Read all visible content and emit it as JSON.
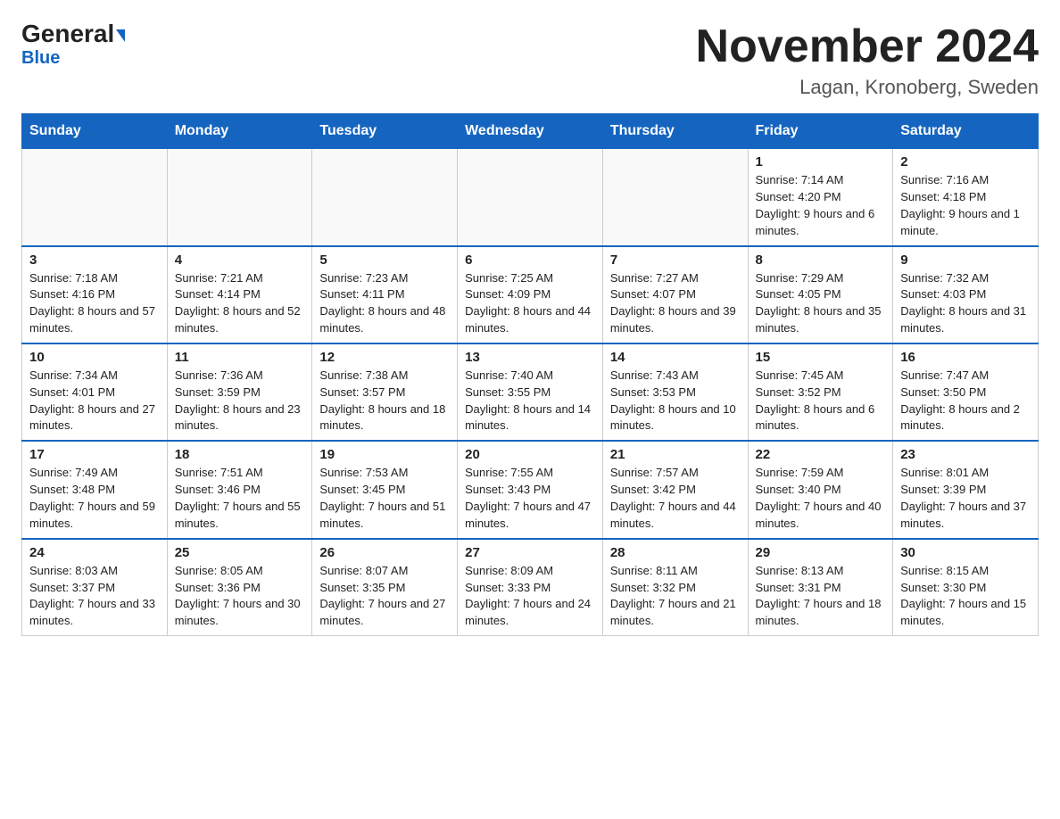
{
  "header": {
    "logo_general": "General",
    "logo_blue": "Blue",
    "month_title": "November 2024",
    "location": "Lagan, Kronoberg, Sweden"
  },
  "weekdays": [
    "Sunday",
    "Monday",
    "Tuesday",
    "Wednesday",
    "Thursday",
    "Friday",
    "Saturday"
  ],
  "weeks": [
    [
      {
        "day": "",
        "info": ""
      },
      {
        "day": "",
        "info": ""
      },
      {
        "day": "",
        "info": ""
      },
      {
        "day": "",
        "info": ""
      },
      {
        "day": "",
        "info": ""
      },
      {
        "day": "1",
        "info": "Sunrise: 7:14 AM\nSunset: 4:20 PM\nDaylight: 9 hours and 6 minutes."
      },
      {
        "day": "2",
        "info": "Sunrise: 7:16 AM\nSunset: 4:18 PM\nDaylight: 9 hours and 1 minute."
      }
    ],
    [
      {
        "day": "3",
        "info": "Sunrise: 7:18 AM\nSunset: 4:16 PM\nDaylight: 8 hours and 57 minutes."
      },
      {
        "day": "4",
        "info": "Sunrise: 7:21 AM\nSunset: 4:14 PM\nDaylight: 8 hours and 52 minutes."
      },
      {
        "day": "5",
        "info": "Sunrise: 7:23 AM\nSunset: 4:11 PM\nDaylight: 8 hours and 48 minutes."
      },
      {
        "day": "6",
        "info": "Sunrise: 7:25 AM\nSunset: 4:09 PM\nDaylight: 8 hours and 44 minutes."
      },
      {
        "day": "7",
        "info": "Sunrise: 7:27 AM\nSunset: 4:07 PM\nDaylight: 8 hours and 39 minutes."
      },
      {
        "day": "8",
        "info": "Sunrise: 7:29 AM\nSunset: 4:05 PM\nDaylight: 8 hours and 35 minutes."
      },
      {
        "day": "9",
        "info": "Sunrise: 7:32 AM\nSunset: 4:03 PM\nDaylight: 8 hours and 31 minutes."
      }
    ],
    [
      {
        "day": "10",
        "info": "Sunrise: 7:34 AM\nSunset: 4:01 PM\nDaylight: 8 hours and 27 minutes."
      },
      {
        "day": "11",
        "info": "Sunrise: 7:36 AM\nSunset: 3:59 PM\nDaylight: 8 hours and 23 minutes."
      },
      {
        "day": "12",
        "info": "Sunrise: 7:38 AM\nSunset: 3:57 PM\nDaylight: 8 hours and 18 minutes."
      },
      {
        "day": "13",
        "info": "Sunrise: 7:40 AM\nSunset: 3:55 PM\nDaylight: 8 hours and 14 minutes."
      },
      {
        "day": "14",
        "info": "Sunrise: 7:43 AM\nSunset: 3:53 PM\nDaylight: 8 hours and 10 minutes."
      },
      {
        "day": "15",
        "info": "Sunrise: 7:45 AM\nSunset: 3:52 PM\nDaylight: 8 hours and 6 minutes."
      },
      {
        "day": "16",
        "info": "Sunrise: 7:47 AM\nSunset: 3:50 PM\nDaylight: 8 hours and 2 minutes."
      }
    ],
    [
      {
        "day": "17",
        "info": "Sunrise: 7:49 AM\nSunset: 3:48 PM\nDaylight: 7 hours and 59 minutes."
      },
      {
        "day": "18",
        "info": "Sunrise: 7:51 AM\nSunset: 3:46 PM\nDaylight: 7 hours and 55 minutes."
      },
      {
        "day": "19",
        "info": "Sunrise: 7:53 AM\nSunset: 3:45 PM\nDaylight: 7 hours and 51 minutes."
      },
      {
        "day": "20",
        "info": "Sunrise: 7:55 AM\nSunset: 3:43 PM\nDaylight: 7 hours and 47 minutes."
      },
      {
        "day": "21",
        "info": "Sunrise: 7:57 AM\nSunset: 3:42 PM\nDaylight: 7 hours and 44 minutes."
      },
      {
        "day": "22",
        "info": "Sunrise: 7:59 AM\nSunset: 3:40 PM\nDaylight: 7 hours and 40 minutes."
      },
      {
        "day": "23",
        "info": "Sunrise: 8:01 AM\nSunset: 3:39 PM\nDaylight: 7 hours and 37 minutes."
      }
    ],
    [
      {
        "day": "24",
        "info": "Sunrise: 8:03 AM\nSunset: 3:37 PM\nDaylight: 7 hours and 33 minutes."
      },
      {
        "day": "25",
        "info": "Sunrise: 8:05 AM\nSunset: 3:36 PM\nDaylight: 7 hours and 30 minutes."
      },
      {
        "day": "26",
        "info": "Sunrise: 8:07 AM\nSunset: 3:35 PM\nDaylight: 7 hours and 27 minutes."
      },
      {
        "day": "27",
        "info": "Sunrise: 8:09 AM\nSunset: 3:33 PM\nDaylight: 7 hours and 24 minutes."
      },
      {
        "day": "28",
        "info": "Sunrise: 8:11 AM\nSunset: 3:32 PM\nDaylight: 7 hours and 21 minutes."
      },
      {
        "day": "29",
        "info": "Sunrise: 8:13 AM\nSunset: 3:31 PM\nDaylight: 7 hours and 18 minutes."
      },
      {
        "day": "30",
        "info": "Sunrise: 8:15 AM\nSunset: 3:30 PM\nDaylight: 7 hours and 15 minutes."
      }
    ]
  ]
}
